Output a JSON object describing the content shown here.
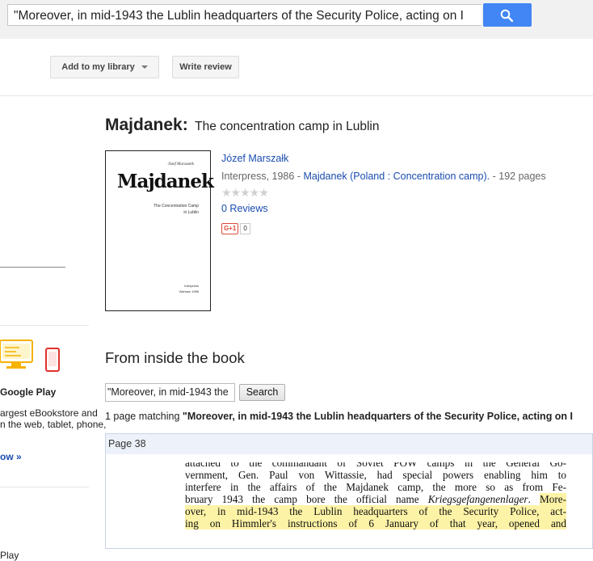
{
  "top_search": {
    "query": "\"Moreover, in mid-1943 the Lublin headquarters of the Security Police, acting on I",
    "button_icon": "search-icon",
    "button_color": "#4285f4"
  },
  "toolbar": {
    "library_label": "Add to my library",
    "review_label": "Write review"
  },
  "book": {
    "title": "Majdanek:",
    "subtitle": "The concentration camp in Lublin",
    "author": "Józef Marszałk",
    "publisher": "Interpress, 1986",
    "separator": " - ",
    "subject": "Majdanek (Poland : Concentration camp).",
    "pages": " - 192 pages",
    "stars": "★★★★★",
    "reviews": "0 Reviews",
    "gplus_label": "G+1",
    "gplus_count": "0",
    "cover": {
      "author": "Józef Marszałek",
      "title": "Majdanek",
      "subtitle_line1": "The Concentration Camp",
      "subtitle_line2": "in Lublin",
      "publisher_line1": "Interpress",
      "publisher_line2": "Warsaw 1986"
    }
  },
  "left_panel": {
    "google_play": "Google Play",
    "line1": "argest eBookstore and",
    "line2": "n the web, tablet, phone,",
    "link": "ow »",
    "bottom": "Play"
  },
  "inside": {
    "heading": "From inside the book",
    "input_value": "\"Moreover, in mid-1943 the",
    "button_label": "Search",
    "matching_prefix": "1 page matching ",
    "matching_query": "\"Moreover, in mid-1943 the Lublin headquarters of the Security Police, acting on I",
    "page_label": "Page 38",
    "lines": [
      "attached to the commandant of Soviet POW camps in the General Go-",
      "vernment, Gen. Paul von Wittassie, had special powers enabling him to",
      "interfere in the affairs of the Majdanek camp, the more so as from Fe-",
      "bruary 1943 the camp bore the official name",
      "Kriegsgefangenenlager",
      ". ",
      "More-",
      "over, in mid-1943 the Lublin headquarters of the Security Police, act-",
      "ing on Himmler's instructions of 6 January of that year, opened and"
    ]
  }
}
